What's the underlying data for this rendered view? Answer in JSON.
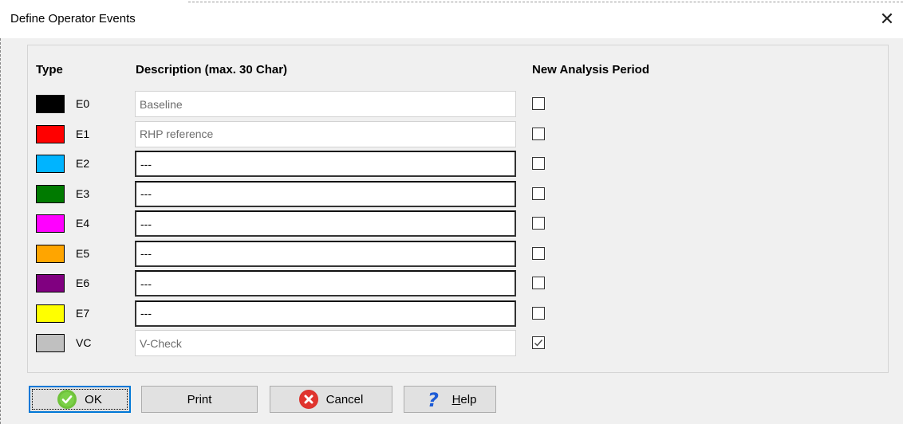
{
  "window": {
    "title": "Define Operator Events",
    "close_glyph": "✕"
  },
  "headers": {
    "type": "Type",
    "description": "Description (max. 30 Char)",
    "new_period": "New Analysis Period"
  },
  "rows": [
    {
      "code": "E0",
      "color": "#000000",
      "description": "Baseline",
      "editable": false,
      "checked": false
    },
    {
      "code": "E1",
      "color": "#ff0000",
      "description": "RHP reference",
      "editable": false,
      "checked": false
    },
    {
      "code": "E2",
      "color": "#00b4ff",
      "description": "---",
      "editable": true,
      "checked": false
    },
    {
      "code": "E3",
      "color": "#007a00",
      "description": "---",
      "editable": true,
      "checked": false
    },
    {
      "code": "E4",
      "color": "#ff00ff",
      "description": "---",
      "editable": true,
      "checked": false
    },
    {
      "code": "E5",
      "color": "#ffa500",
      "description": "---",
      "editable": true,
      "checked": false
    },
    {
      "code": "E6",
      "color": "#800080",
      "description": "---",
      "editable": true,
      "checked": false
    },
    {
      "code": "E7",
      "color": "#ffff00",
      "description": "---",
      "editable": true,
      "checked": false
    },
    {
      "code": "VC",
      "color": "#c0c0c0",
      "description": "V-Check",
      "editable": false,
      "checked": true
    }
  ],
  "buttons": {
    "ok": "OK",
    "print": "Print",
    "cancel": "Cancel",
    "help_prefix": "H",
    "help_rest": "elp"
  },
  "icons": {
    "ok": "check-circle-icon",
    "cancel": "error-circle-icon",
    "help": "question-mark-icon"
  }
}
